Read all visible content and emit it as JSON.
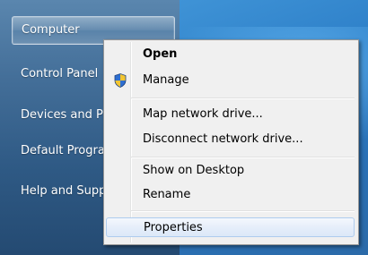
{
  "start_menu": {
    "items": [
      {
        "label": "Computer"
      },
      {
        "label": "Control Panel"
      },
      {
        "label": "Devices and Pr"
      },
      {
        "label": "Default Progra"
      },
      {
        "label": "Help and Supp"
      }
    ]
  },
  "context_menu": {
    "items": [
      {
        "label": "Open"
      },
      {
        "label": "Manage",
        "icon": "uac-shield-icon"
      },
      {
        "label": "Map network drive..."
      },
      {
        "label": "Disconnect network drive..."
      },
      {
        "label": "Show on Desktop"
      },
      {
        "label": "Rename"
      },
      {
        "label": "Properties"
      }
    ]
  },
  "colors": {
    "menu_background": "#f0f0f0",
    "hover_border": "#aeccee",
    "desktop_blue": "#2d7fc8"
  }
}
